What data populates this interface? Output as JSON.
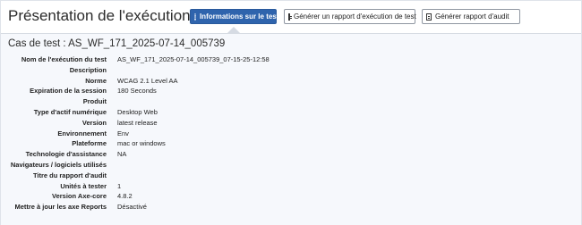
{
  "header": {
    "title": "Présentation de l'exécution du test",
    "buttons": {
      "info": "Informations sur le test",
      "report": "Générer un rapport d'exécution de test",
      "audit": "Générer rapport d'audit"
    },
    "icons": {
      "info": "info-circle-icon",
      "report": "document-icon",
      "audit": "document-icon"
    },
    "accent_color": "#2f64ad"
  },
  "test_case": {
    "heading": "Cas de test : AS_WF_171_2025-07-14_005739"
  },
  "details": [
    {
      "label": "Nom de l'exécution du test",
      "value": "AS_WF_171_2025-07-14_005739_07-15-25-12:58"
    },
    {
      "label": "Description",
      "value": ""
    },
    {
      "label": "Norme",
      "value": "WCAG 2.1 Level AA"
    },
    {
      "label": "Expiration de la session",
      "value": "180 Seconds"
    },
    {
      "label": "Produit",
      "value": ""
    },
    {
      "label": "Type d'actif numérique",
      "value": "Desktop Web"
    },
    {
      "label": "Version",
      "value": "latest release"
    },
    {
      "label": "Environnement",
      "value": "Env"
    },
    {
      "label": "Plateforme",
      "value": "mac or windows"
    },
    {
      "label": "Technologie d'assistance",
      "value": "NA"
    },
    {
      "label": "Navigateurs / logiciels utilisés",
      "value": ""
    },
    {
      "label": "Titre du rapport d'audit",
      "value": ""
    },
    {
      "label": "Unités à tester",
      "value": "1"
    },
    {
      "label": "Version Axe-core",
      "value": "4.8.2"
    },
    {
      "label": "Mettre à jour les axe Reports",
      "value": "Désactivé"
    }
  ]
}
